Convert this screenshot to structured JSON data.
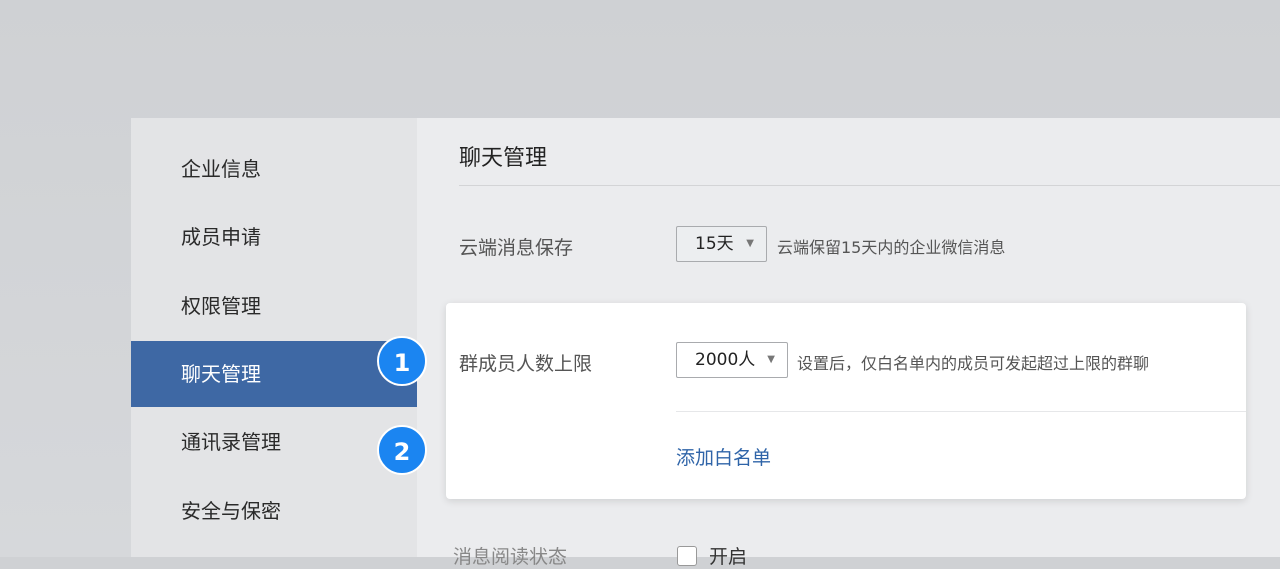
{
  "sidebar": {
    "items": [
      {
        "label": "企业信息"
      },
      {
        "label": "成员申请"
      },
      {
        "label": "权限管理"
      },
      {
        "label": "聊天管理"
      },
      {
        "label": "通讯录管理"
      },
      {
        "label": "安全与保密"
      }
    ]
  },
  "main": {
    "title": "聊天管理",
    "cloud": {
      "label": "云端消息保存",
      "value": "15天",
      "hint": "云端保留15天内的企业微信消息"
    },
    "group": {
      "label": "群成员人数上限",
      "value": "2000人",
      "hint": "设置后，仅白名单内的成员可发起超过上限的群聊",
      "link": "添加白名单"
    },
    "read": {
      "label": "消息阅读状态",
      "option": "开启"
    }
  },
  "badges": [
    "1",
    "2"
  ],
  "arrow": "▼"
}
